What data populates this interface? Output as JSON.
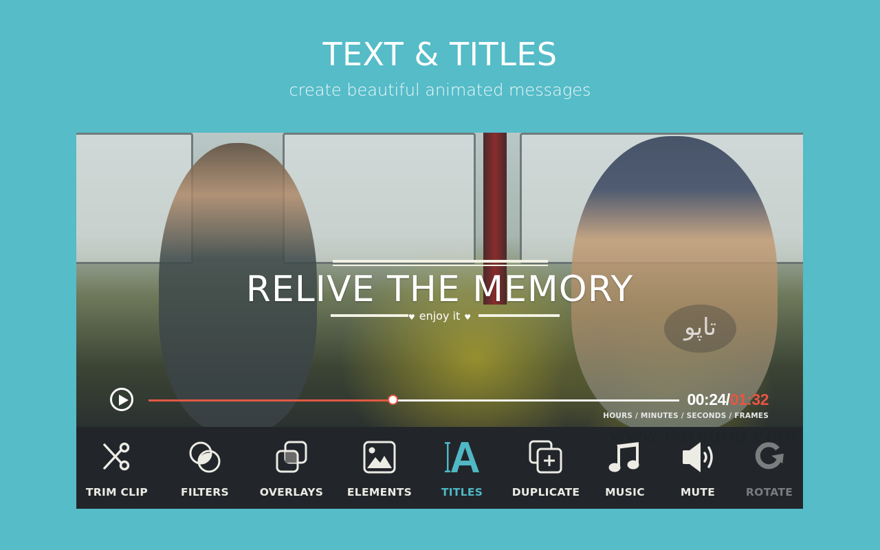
{
  "header": {
    "title": "TEXT & TITLES",
    "subtitle": "create beautiful animated messages"
  },
  "preview": {
    "title_text": "RELIVE THE MEMORY",
    "subtitle_text": "enjoy it",
    "logo_watermark": "تاپو",
    "icons": {
      "play": "play-icon"
    }
  },
  "playback": {
    "progress_fraction": 0.46,
    "current_time": "00:24",
    "separator": "/",
    "total_time": "01:32",
    "units_label": "HOURS / MINUTES / SECONDS / FRAMES",
    "colors": {
      "played": "#e25a43",
      "remaining": "#f4f4f4",
      "total_time": "#e85543"
    }
  },
  "toolbar": {
    "items": [
      {
        "label": "TRIM CLIP",
        "icon": "scissors-icon",
        "state": "normal"
      },
      {
        "label": "FILTERS",
        "icon": "filters-icon",
        "state": "normal"
      },
      {
        "label": "OVERLAYS",
        "icon": "overlays-icon",
        "state": "normal"
      },
      {
        "label": "ELEMENTS",
        "icon": "image-icon",
        "state": "normal"
      },
      {
        "label": "TITLES",
        "icon": "text-cursor-icon",
        "state": "active"
      },
      {
        "label": "DUPLICATE",
        "icon": "duplicate-icon",
        "state": "normal"
      },
      {
        "label": "MUSIC",
        "icon": "music-note-icon",
        "state": "normal"
      },
      {
        "label": "MUTE",
        "icon": "speaker-icon",
        "state": "normal"
      },
      {
        "label": "ROTATE",
        "icon": "rotate-icon",
        "state": "disabled"
      }
    ],
    "colors": {
      "background": "#22262b",
      "active": "#4fb8c4",
      "normal": "#ecebe4",
      "disabled": "#7b7d7f"
    }
  },
  "watermark": "www.Patoghu.com",
  "theme": {
    "background": "#55bcc8"
  }
}
